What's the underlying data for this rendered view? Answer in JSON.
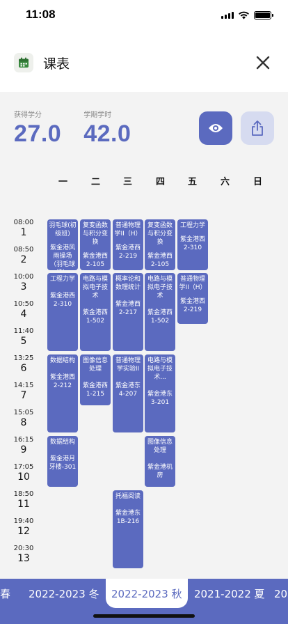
{
  "status_bar": {
    "time": "11:08"
  },
  "header": {
    "title": "课表"
  },
  "stats": {
    "credits_label": "获得学分",
    "credits_value": "27.0",
    "hours_label": "学期学时",
    "hours_value": "42.0"
  },
  "days": [
    "一",
    "二",
    "三",
    "四",
    "五",
    "六",
    "日"
  ],
  "periods": [
    {
      "time": "08:00",
      "num": "1"
    },
    {
      "time": "08:50",
      "num": "2"
    },
    {
      "time": "10:00",
      "num": "3"
    },
    {
      "time": "10:50",
      "num": "4"
    },
    {
      "time": "11:40",
      "num": "5"
    },
    {
      "time": "13:25",
      "num": "6"
    },
    {
      "time": "14:15",
      "num": "7"
    },
    {
      "time": "15:05",
      "num": "8"
    },
    {
      "time": "16:15",
      "num": "9"
    },
    {
      "time": "17:05",
      "num": "10"
    },
    {
      "time": "18:50",
      "num": "11"
    },
    {
      "time": "19:40",
      "num": "12"
    },
    {
      "time": "20:30",
      "num": "13"
    }
  ],
  "courses": [
    {
      "name": "羽毛球(初级班)",
      "room": "紫金港风雨操场（羽毛球场）"
    },
    {
      "name": "复变函数与积分变换",
      "room": "紫金港西2-105"
    },
    {
      "name": "普通物理学II（H）",
      "room": "紫金港西2-219"
    },
    {
      "name": "复变函数与积分变换",
      "room": "紫金港西2-105"
    },
    {
      "name": "工程力学",
      "room": "紫金港西2-310"
    },
    {
      "name": "工程力学",
      "room": "紫金港西2-310"
    },
    {
      "name": "电路与模拟电子技术",
      "room": "紫金港西1-502"
    },
    {
      "name": "概率论和数理统计",
      "room": "紫金港西2-217"
    },
    {
      "name": "电路与模拟电子技术",
      "room": "紫金港西1-502"
    },
    {
      "name": "普通物理学II（H）",
      "room": "紫金港西2-219"
    },
    {
      "name": "数据结构",
      "room": "紫金港西2-212"
    },
    {
      "name": "图像信息处理",
      "room": "紫金港西1-215"
    },
    {
      "name": "普通物理学实验II",
      "room": "紫金港东4-207"
    },
    {
      "name": "电路与模拟电子技术...",
      "room": "紫金港东3-201"
    },
    {
      "name": "数据结构",
      "room": "紫金港月牙楼-301"
    },
    {
      "name": "图像信息处理",
      "room": "紫金港机房"
    },
    {
      "name": "托福阅读",
      "room": "紫金港东1B-216"
    }
  ],
  "semester_tabs": [
    "春",
    "2022-2023 冬",
    "2022-2023 秋",
    "2021-2022 夏",
    "20"
  ]
}
